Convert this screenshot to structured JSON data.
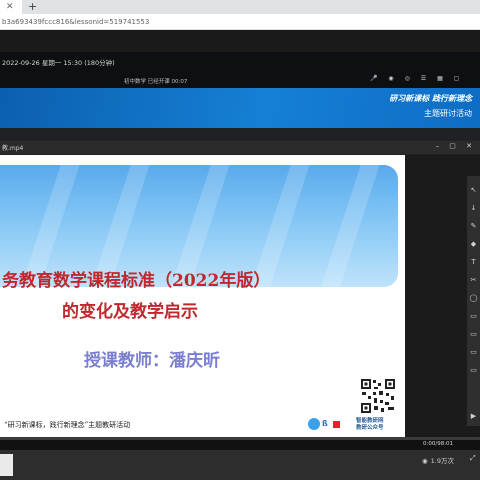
{
  "browser": {
    "tab_close": "✕",
    "new_tab": "+",
    "url": "b3a693439fccc816&lessonid=519741553"
  },
  "infobar": {
    "datetime": "2022-09-26 星期一 15:30 (180分钟)",
    "course": "初中数学    已经开课 00:07",
    "icons": [
      "mic-icon",
      "volume-icon",
      "chat-icon",
      "menu-icon",
      "grid-icon",
      "window-icon"
    ]
  },
  "banner": {
    "title": "研习新课标  践行新理念",
    "subtitle": "主题研讨活动"
  },
  "video": {
    "filename": "教.mp4",
    "window_controls": "– ▢ ✕"
  },
  "slide": {
    "title_line1": "务教育数学课程标准（2022年版）",
    "title_line2": "的变化及教学启示",
    "teacher": "授课教师：潘庆昕",
    "footer": "“研习新课标，践行新理念”主题教研活动",
    "logo_text": "ß",
    "qr_caption_line1": "智能教研网",
    "qr_caption_line2": "教研公众号"
  },
  "toolbar": {
    "tools": [
      "↖",
      "↓",
      "✎",
      "◆",
      "T",
      "✂",
      "◯",
      "▭",
      "▭",
      "▭",
      "▭",
      "▶"
    ]
  },
  "player": {
    "progress": 0.0,
    "timecode": "0:00/98:01",
    "views": "1.9万次",
    "expand": "⤢"
  },
  "colors": {
    "banner": "#1580d4",
    "slide_title": "#c1272d",
    "teacher": "#7b7fcf"
  }
}
